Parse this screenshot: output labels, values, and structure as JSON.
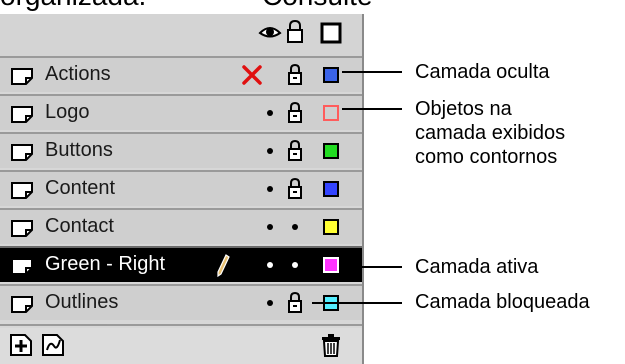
{
  "top_text": {
    "left": "organizada.",
    "right": "Consulte"
  },
  "layers": [
    {
      "name": "Actions",
      "visibility": "hidden",
      "locked": true,
      "active": false,
      "color": "#3a63e8",
      "outline": false
    },
    {
      "name": "Logo",
      "visibility": "visible",
      "locked": true,
      "active": false,
      "color": "#ff5c5c",
      "outline": true
    },
    {
      "name": "Buttons",
      "visibility": "visible",
      "locked": true,
      "active": false,
      "color": "#22dd22",
      "outline": false
    },
    {
      "name": "Content",
      "visibility": "visible",
      "locked": true,
      "active": false,
      "color": "#3344ff",
      "outline": false
    },
    {
      "name": "Contact",
      "visibility": "visible",
      "locked": false,
      "active": false,
      "color": "#ffff33",
      "outline": false
    },
    {
      "name": "Green - Right",
      "visibility": "visible",
      "locked": false,
      "active": true,
      "color": "#ff33ff",
      "outline": false
    },
    {
      "name": "Outlines",
      "visibility": "visible",
      "locked": true,
      "active": false,
      "color": "#55eeff",
      "outline": false
    }
  ],
  "callouts": {
    "hidden": "Camada oculta",
    "outline_line1": "Objetos na",
    "outline_line2": "camada exibidos",
    "outline_line3": "como contornos",
    "active": "Camada ativa",
    "locked": "Camada bloqueada"
  },
  "icons": {
    "header": [
      "eye-icon",
      "lock-icon",
      "outline-square-icon"
    ],
    "layer": "layer-doc-icon",
    "bottom": [
      "add-layer-icon",
      "add-guide-layer-icon",
      "trash-icon"
    ]
  }
}
